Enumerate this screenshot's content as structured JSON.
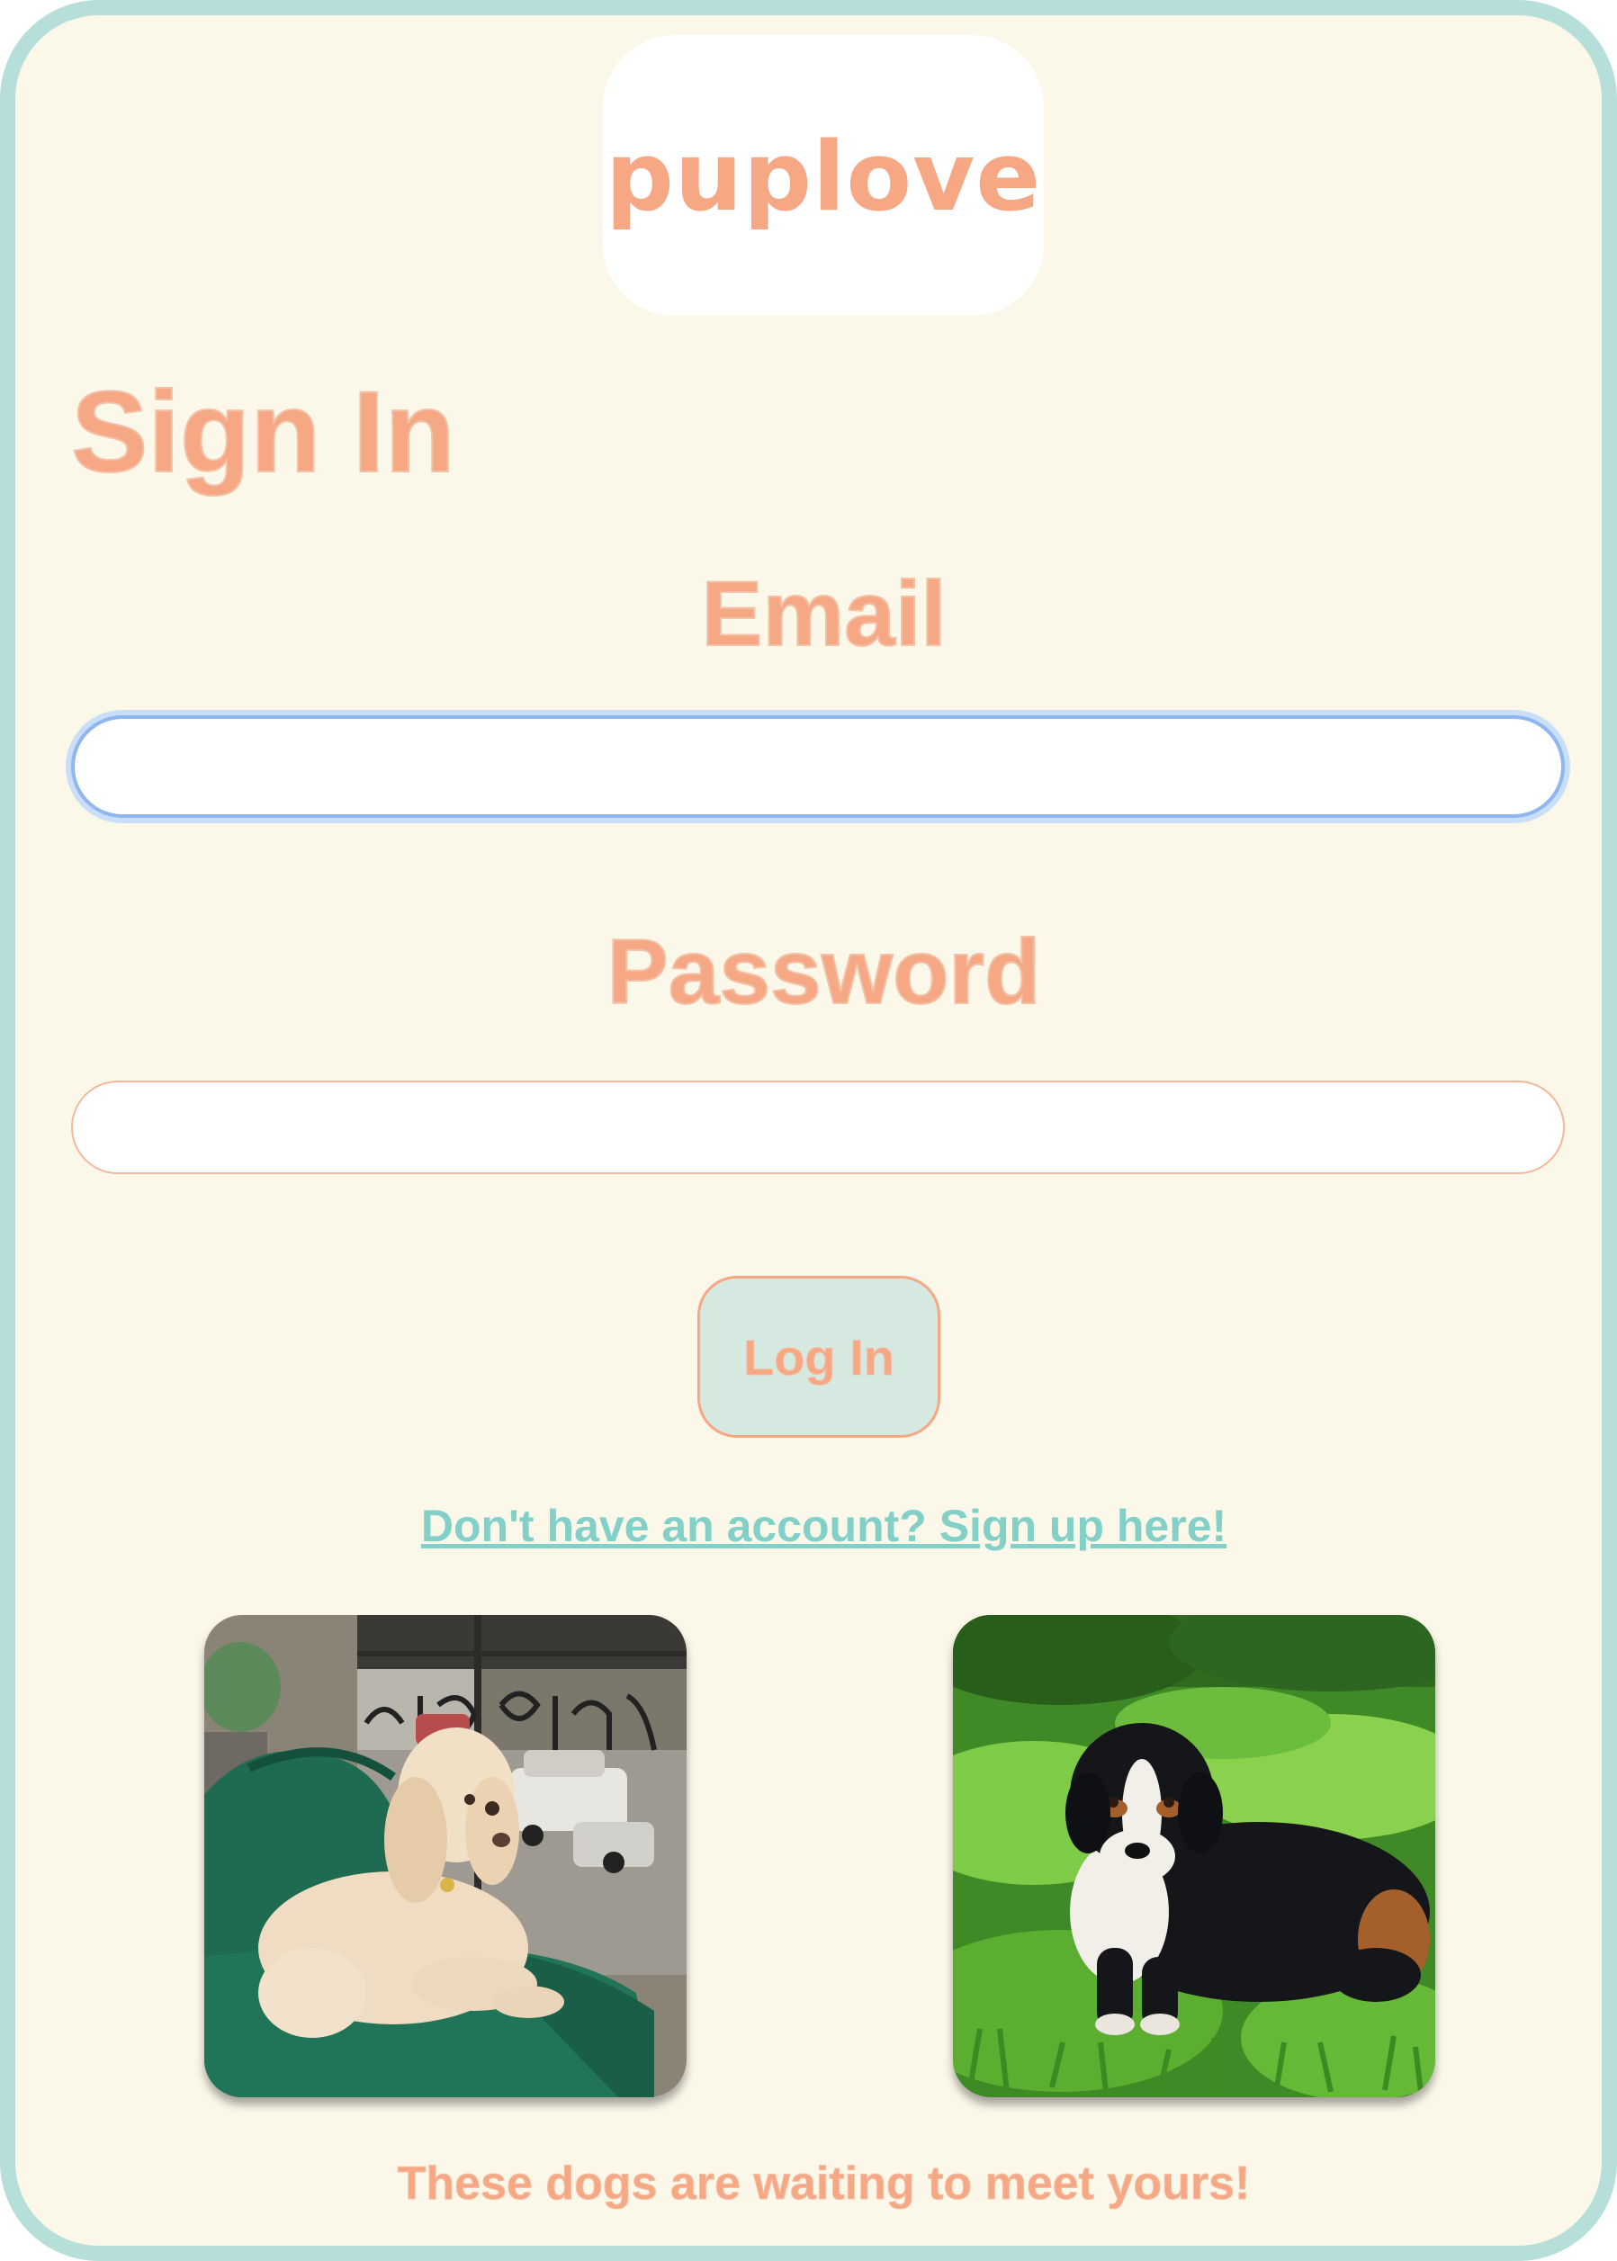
{
  "app": {
    "logo_text": "puplove"
  },
  "form": {
    "heading": "Sign In",
    "email_label": "Email",
    "email_value": "",
    "password_label": "Password",
    "password_value": "",
    "login_button": "Log In",
    "signup_link": "Don't have an account? Sign up here!"
  },
  "gallery": {
    "photos": [
      {
        "icon": "goldendoodle-on-couch-photo"
      },
      {
        "icon": "bernese-mountain-dog-in-grass-photo"
      }
    ],
    "caption": "These dogs are waiting to meet yours!"
  },
  "colors": {
    "accent": "#f6a784",
    "frame_border": "#b7dfd9",
    "background": "#fcf8e9",
    "link": "#83d0c9",
    "button_bg": "#d5e9e0",
    "focus_ring": "#8fb6ee"
  }
}
